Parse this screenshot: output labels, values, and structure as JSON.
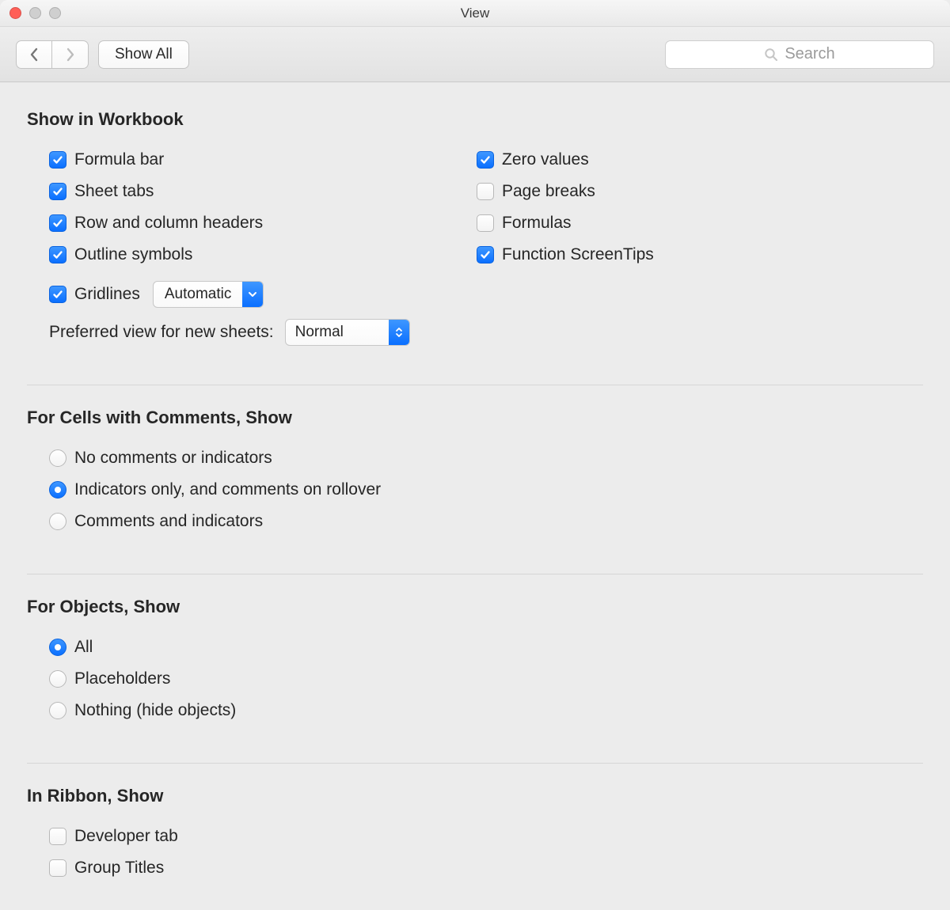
{
  "window_title": "View",
  "toolbar": {
    "show_all": "Show All",
    "search_placeholder": "Search"
  },
  "sections": {
    "show_in_workbook": {
      "title": "Show in Workbook",
      "formula_bar": "Formula bar",
      "sheet_tabs": "Sheet tabs",
      "row_col_headers": "Row and column headers",
      "outline_symbols": "Outline symbols",
      "gridlines": "Gridlines",
      "gridlines_mode": "Automatic",
      "zero_values": "Zero values",
      "page_breaks": "Page breaks",
      "formulas": "Formulas",
      "function_screentips": "Function ScreenTips",
      "preferred_view_label": "Preferred view for new sheets:",
      "preferred_view_value": "Normal"
    },
    "comments": {
      "title": "For Cells with Comments, Show",
      "none": "No comments or indicators",
      "indicators_only": "Indicators only, and comments on rollover",
      "both": "Comments and indicators"
    },
    "objects": {
      "title": "For Objects, Show",
      "all": "All",
      "placeholders": "Placeholders",
      "nothing": "Nothing (hide objects)"
    },
    "ribbon": {
      "title": "In Ribbon, Show",
      "developer_tab": "Developer tab",
      "group_titles": "Group Titles"
    }
  },
  "state": {
    "checkboxes": {
      "formula_bar": true,
      "sheet_tabs": true,
      "row_col_headers": true,
      "outline_symbols": true,
      "gridlines": true,
      "zero_values": true,
      "page_breaks": false,
      "formulas": false,
      "function_screentips": true,
      "developer_tab": false,
      "group_titles": false
    },
    "radios": {
      "comments": "indicators_only",
      "objects": "all"
    }
  }
}
